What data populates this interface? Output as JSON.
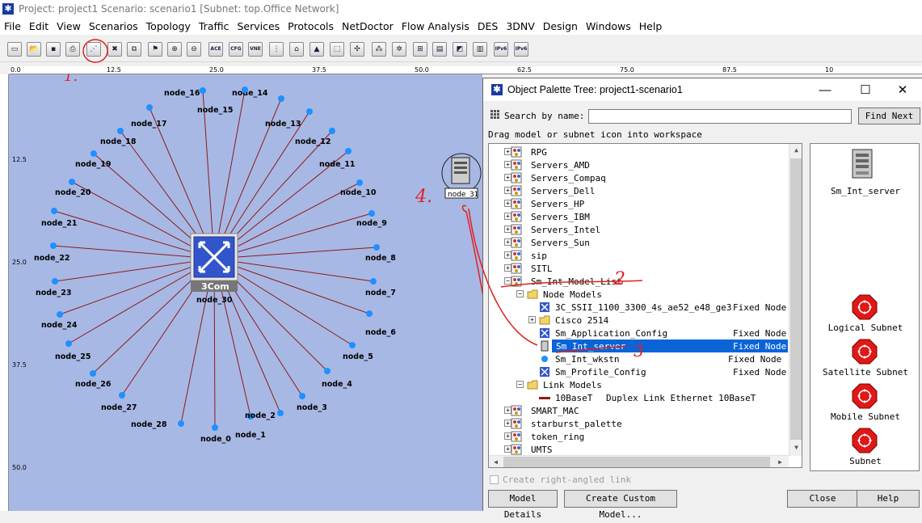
{
  "window": {
    "title": "Project: project1 Scenario: scenario1  [Subnet: top.Office Network]"
  },
  "menu": [
    "File",
    "Edit",
    "View",
    "Scenarios",
    "Topology",
    "Traffic",
    "Services",
    "Protocols",
    "NetDoctor",
    "Flow Analysis",
    "DES",
    "3DNV",
    "Design",
    "Windows",
    "Help"
  ],
  "toolbar": {
    "buttons": [
      "new-icon",
      "open-icon",
      "save-icon",
      "print-icon",
      "object-palette-icon",
      "delete-icon",
      "duplicate-icon",
      "fail-icon",
      "zoom-in-icon",
      "zoom-out-icon",
      "ace-icon",
      "cfg-icon",
      "vne-icon",
      "traffic-light-icon",
      "bookmark-icon",
      "triangle-icon",
      "select-icon",
      "verify-links-icon",
      "nodes-icon",
      "topology-icon",
      "hierarchy-icon",
      "report-icon",
      "graph-icon",
      "results-icon",
      "ipv6-icon",
      "ipv6-alt-icon"
    ],
    "labels": {
      "ace": "ACE",
      "cfg": "CFG",
      "vne": "VNE",
      "ipv6": "IPv6"
    }
  },
  "ruler": {
    "top_ticks": [
      "0.0",
      "12.5",
      "25.0",
      "37.5",
      "50.0",
      "62.5",
      "75.0",
      "87.5",
      "10"
    ],
    "left_ticks": [
      "12.5",
      "25.0",
      "37.5",
      "50.0"
    ]
  },
  "workspace": {
    "hub": {
      "label": "node_30",
      "brand": "3Com"
    },
    "server": {
      "label": "node_31"
    },
    "nodes": [
      "node_0",
      "node_1",
      "node_2",
      "node_3",
      "node_4",
      "node_5",
      "node_6",
      "node_7",
      "node_8",
      "node_9",
      "node_10",
      "node_11",
      "node_12",
      "node_13",
      "node_14",
      "node_15",
      "node_16",
      "node_17",
      "node_18",
      "node_19",
      "node_20",
      "node_21",
      "node_22",
      "node_23",
      "node_24",
      "node_25",
      "node_26",
      "node_27",
      "node_28"
    ],
    "annotations": [
      "1.",
      "2",
      "3",
      "4."
    ],
    "colors": {
      "background": "#a8b8e4",
      "link": "#8b1a1a",
      "node": "#1e90ff",
      "annotation": "#e02020"
    }
  },
  "palette": {
    "title": "Object Palette Tree: project1-scenario1",
    "search_label": "Search by name:",
    "search_value": "",
    "find_next": "Find Next",
    "drag_hint": "Drag model or subnet icon into workspace",
    "tree": [
      {
        "label": "RPG",
        "type": "",
        "depth": 0
      },
      {
        "label": "Servers_AMD",
        "type": "",
        "depth": 0
      },
      {
        "label": "Servers_Compaq",
        "type": "",
        "depth": 0
      },
      {
        "label": "Servers_Dell",
        "type": "",
        "depth": 0
      },
      {
        "label": "Servers_HP",
        "type": "",
        "depth": 0
      },
      {
        "label": "Servers_IBM",
        "type": "",
        "depth": 0
      },
      {
        "label": "Servers_Intel",
        "type": "",
        "depth": 0
      },
      {
        "label": "Servers_Sun",
        "type": "",
        "depth": 0
      },
      {
        "label": "sip",
        "type": "",
        "depth": 0
      },
      {
        "label": "SITL",
        "type": "",
        "depth": 0
      },
      {
        "label": "Sm_Int_Model_List",
        "type": "",
        "depth": 0
      },
      {
        "label": "Node Models",
        "type": "",
        "depth": 1
      },
      {
        "label": "3C_SSII_1100_3300_4s_ae52_e48_ge3",
        "type": "Fixed Node",
        "depth": 2
      },
      {
        "label": "Cisco 2514",
        "type": "",
        "depth": 2
      },
      {
        "label": "Sm_Application_Config",
        "type": "Fixed Node",
        "depth": 2
      },
      {
        "label": "Sm_Int_server",
        "type": "Fixed Node",
        "depth": 2,
        "selected": true
      },
      {
        "label": "Sm_Int_wkstn",
        "type": "Fixed Node",
        "depth": 2
      },
      {
        "label": "Sm_Profile_Config",
        "type": "Fixed Node",
        "depth": 2
      },
      {
        "label": "Link Models",
        "type": "",
        "depth": 1
      },
      {
        "label": "10BaseT",
        "type": "Duplex Link    Ethernet 10BaseT",
        "depth": 2
      },
      {
        "label": "SMART_MAC",
        "type": "",
        "depth": 0
      },
      {
        "label": "starburst_palette",
        "type": "",
        "depth": 0
      },
      {
        "label": "token_ring",
        "type": "",
        "depth": 0
      },
      {
        "label": "UMTS",
        "type": "",
        "depth": 0
      }
    ],
    "preview": {
      "label": "Sm_Int_server"
    },
    "subnets": [
      "Logical Subnet",
      "Satellite Subnet",
      "Mobile Subnet",
      "Subnet"
    ],
    "checkbox": "Create right-angled link",
    "buttons": {
      "details": "Model Details",
      "custom": "Create Custom Model...",
      "close": "Close",
      "help": "Help"
    }
  }
}
